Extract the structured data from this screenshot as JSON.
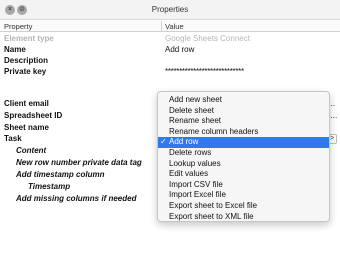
{
  "window": {
    "title": "Properties",
    "close_glyph": "×",
    "second_glyph": "⊘"
  },
  "columns": {
    "property": "Property",
    "value": "Value"
  },
  "rows": [
    {
      "name": "Element type",
      "value": "Google Sheets Connect"
    },
    {
      "name": "Name",
      "value": "Add row"
    },
    {
      "name": "Description",
      "value": ""
    },
    {
      "name": "Private key",
      "value": "****************************"
    },
    {
      "name": "Client email",
      "value_fragment": "l.gs..."
    },
    {
      "name": "Spreadsheet ID",
      "value_fragment": "VAq..."
    },
    {
      "name": "Sheet name",
      "value": ""
    },
    {
      "name": "Task",
      "value": ""
    },
    {
      "name": "Content",
      "value": ""
    },
    {
      "name": "New row number private data tag",
      "value": ""
    },
    {
      "name": "Add timestamp column",
      "value": ""
    },
    {
      "name": "Timestamp",
      "value": ""
    },
    {
      "name": "Add missing columns if needed",
      "value": ""
    }
  ],
  "task_dropdown": {
    "selected": "Add row",
    "more_glyph": ">",
    "options": [
      "Add new sheet",
      "Delete sheet",
      "Rename sheet",
      "Rename column headers",
      "Add row",
      "Delete rows",
      "Lookup values",
      "Edit values",
      "Import CSV file",
      "Import Excel file",
      "Export sheet to Excel file",
      "Export sheet to XML file"
    ],
    "check_glyph": "✓"
  },
  "colors": {
    "selection": "#2f79e8",
    "muted_text": "#b5b5b5",
    "menu_background": "#f6f6f6"
  }
}
